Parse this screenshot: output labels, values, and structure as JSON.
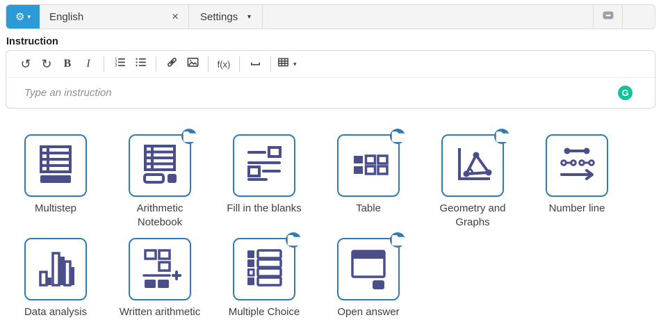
{
  "colors": {
    "accent_blue": "#2d9ad8",
    "tile_border_blue": "#2e7cb7",
    "icon_navy": "#4a4e8a",
    "grammarly_green": "#15c39a",
    "topbar_bg": "#f4f4f5"
  },
  "topbar": {
    "gear_button": {
      "gear_glyph": "⚙",
      "caret_glyph": "▾"
    },
    "tabs": [
      {
        "label": "English",
        "close_glyph": "×"
      },
      {
        "label": "Settings",
        "caret_glyph": "▾"
      }
    ],
    "right_button_icon": "card-minus-icon"
  },
  "instruction": {
    "title": "Instruction",
    "placeholder": "Type an instruction",
    "toolbar_icons": [
      "undo",
      "redo",
      "bold",
      "italic",
      "ordered-list",
      "unordered-list",
      "link",
      "image",
      "formula",
      "blank-space",
      "table"
    ],
    "undo_glyph": "↺",
    "redo_glyph": "↻",
    "bold_glyph": "B",
    "italic_glyph": "I",
    "formula_label": "f(x)",
    "table_caret_glyph": "▾",
    "grammarly_glyph": "G"
  },
  "tiles": [
    {
      "label": "Multistep",
      "badge": false
    },
    {
      "label": "Arithmetic Notebook",
      "badge": true
    },
    {
      "label": "Fill in the blanks",
      "badge": false
    },
    {
      "label": "Table",
      "badge": true
    },
    {
      "label": "Geometry and Graphs",
      "badge": true
    },
    {
      "label": "Number line",
      "badge": false
    },
    {
      "label": "Data analysis",
      "badge": false
    },
    {
      "label": "Written arithmetic",
      "badge": false
    },
    {
      "label": "Multiple Choice",
      "badge": true
    },
    {
      "label": "Open answer",
      "badge": true
    }
  ]
}
